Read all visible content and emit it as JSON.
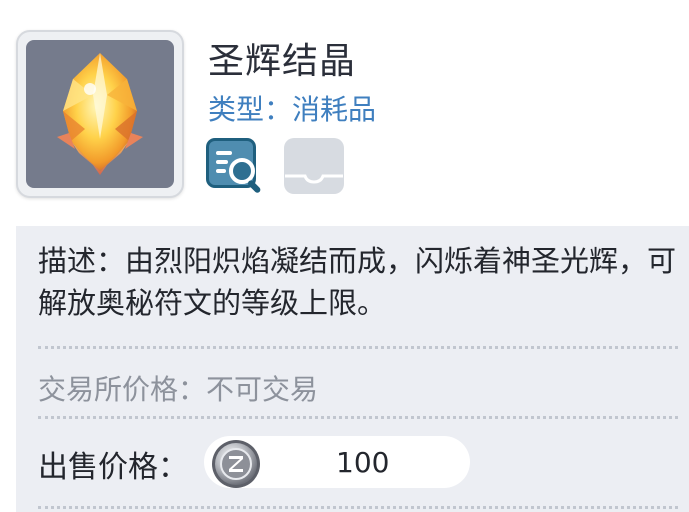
{
  "item": {
    "name": "圣辉结晶",
    "type_text": "类型：消耗品"
  },
  "icons": {
    "item_image": "golden-crystal-icon",
    "details": "item-inspect-icon",
    "placeholder": "empty-tray-icon"
  },
  "details": {
    "description": "描述：由烈阳炽焰凝结而成，闪烁着神圣光辉，可解放奥秘符文的等级上限。",
    "trade_text": "交易所价格：不可交易",
    "sell_label": "出售价格：",
    "sell_price": "100",
    "currency_icon": "zeny-coin-icon"
  },
  "colors": {
    "type_text": "#3f7fbf",
    "panel_bg": "#eceef3",
    "item_bg": "#757b8c"
  }
}
